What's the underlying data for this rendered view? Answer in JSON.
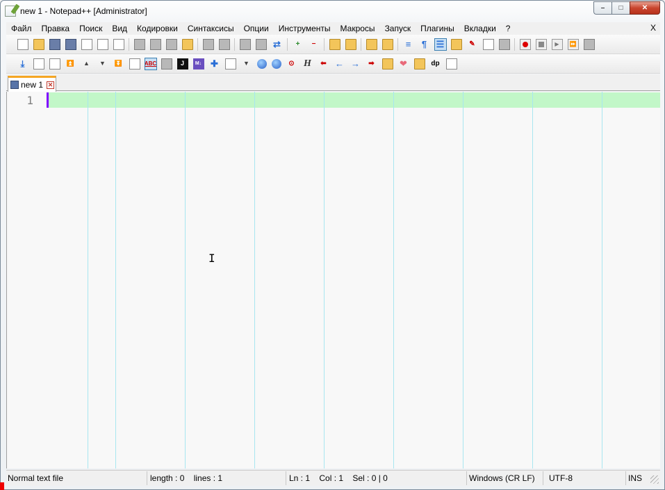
{
  "window": {
    "title": "new 1 - Notepad++ [Administrator]",
    "controls": {
      "minimize": "–",
      "maximize": "□",
      "close": "✕"
    }
  },
  "menu": {
    "items": [
      "Файл",
      "Правка",
      "Поиск",
      "Вид",
      "Кодировки",
      "Синтаксисы",
      "Опции",
      "Инструменты",
      "Макросы",
      "Запуск",
      "Плагины",
      "Вкладки",
      "?"
    ],
    "close": "X"
  },
  "toolbar_icons": {
    "dp": "dp",
    "h": "H",
    "j": "J",
    "md": "M↓",
    "abc": "ABC",
    "pilcrow": "¶"
  },
  "tabs": [
    {
      "label": "new 1",
      "close": "✕"
    }
  ],
  "editor": {
    "line_numbers": [
      "1"
    ],
    "caret_line_color": "#c2f7c8",
    "caret_color": "#8000ff",
    "edge_color": "#a8e6f0"
  },
  "statusbar": {
    "file_type": "Normal text file",
    "length": "length : 0    lines : 1",
    "position": "Ln : 1    Col : 1    Sel : 0 | 0",
    "eol": "Windows (CR LF)",
    "encoding": "UTF-8",
    "mode": "INS"
  }
}
